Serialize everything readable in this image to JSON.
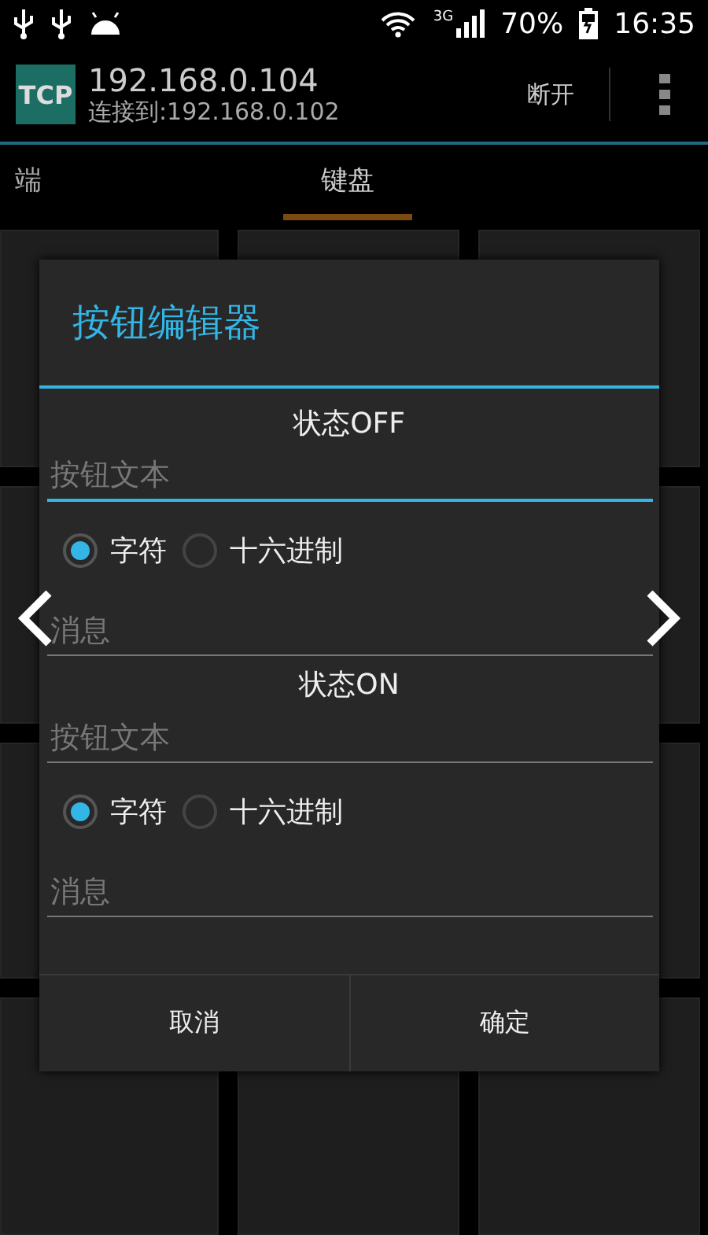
{
  "status_bar": {
    "network": "3G",
    "battery": "70%",
    "time": "16:35"
  },
  "app_bar": {
    "badge": "TCP",
    "title": "192.168.0.104",
    "subtitle": "连接到:192.168.0.102",
    "action": "断开"
  },
  "tabs": [
    {
      "label": "端",
      "selected": false
    },
    {
      "label": "键盘",
      "selected": true
    }
  ],
  "dialog": {
    "title": "按钮编辑器",
    "sections": [
      {
        "heading": "状态OFF",
        "text_field": {
          "placeholder": "按钮文本",
          "focused": true
        },
        "radios": [
          {
            "label": "字符",
            "selected": true
          },
          {
            "label": "十六进制",
            "selected": false
          }
        ],
        "message_field": {
          "placeholder": "消息",
          "focused": false
        }
      },
      {
        "heading": "状态ON",
        "text_field": {
          "placeholder": "按钮文本",
          "focused": false
        },
        "radios": [
          {
            "label": "字符",
            "selected": true
          },
          {
            "label": "十六进制",
            "selected": false
          }
        ],
        "message_field": {
          "placeholder": "消息",
          "focused": false
        }
      }
    ],
    "buttons": [
      "取消",
      "确定"
    ]
  }
}
